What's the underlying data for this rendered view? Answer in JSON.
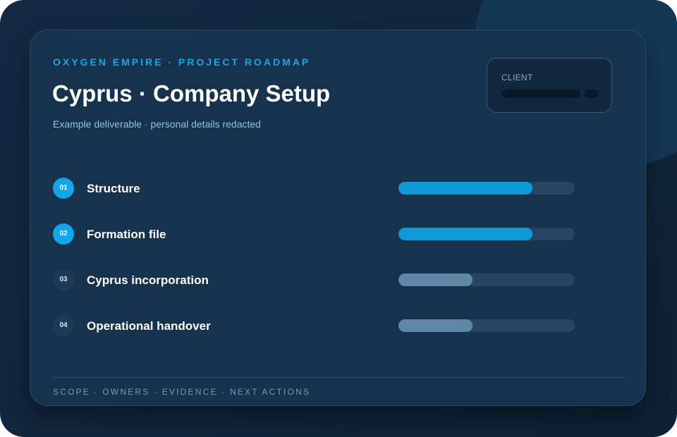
{
  "header": {
    "eyebrow": "OXYGEN EMPIRE · PROJECT ROADMAP",
    "title": "Cyprus · Company Setup",
    "subtitle": "Example deliverable · personal details redacted"
  },
  "client": {
    "label": "CLIENT"
  },
  "steps": [
    {
      "number": "01",
      "label": "Structure",
      "status": "active",
      "progress": 0.76
    },
    {
      "number": "02",
      "label": "Formation file",
      "status": "active",
      "progress": 0.76
    },
    {
      "number": "03",
      "label": "Cyprus incorporation",
      "status": "pending",
      "progress": 0.42
    },
    {
      "number": "04",
      "label": "Operational handover",
      "status": "pending",
      "progress": 0.42
    }
  ],
  "footer": {
    "text": "SCOPE · OWNERS · EVIDENCE · NEXT ACTIONS"
  },
  "colors": {
    "accent": "#11a6ea",
    "active_fill": "#0d9ad6",
    "pending_fill": "#5f88a8",
    "track": "#284661"
  }
}
